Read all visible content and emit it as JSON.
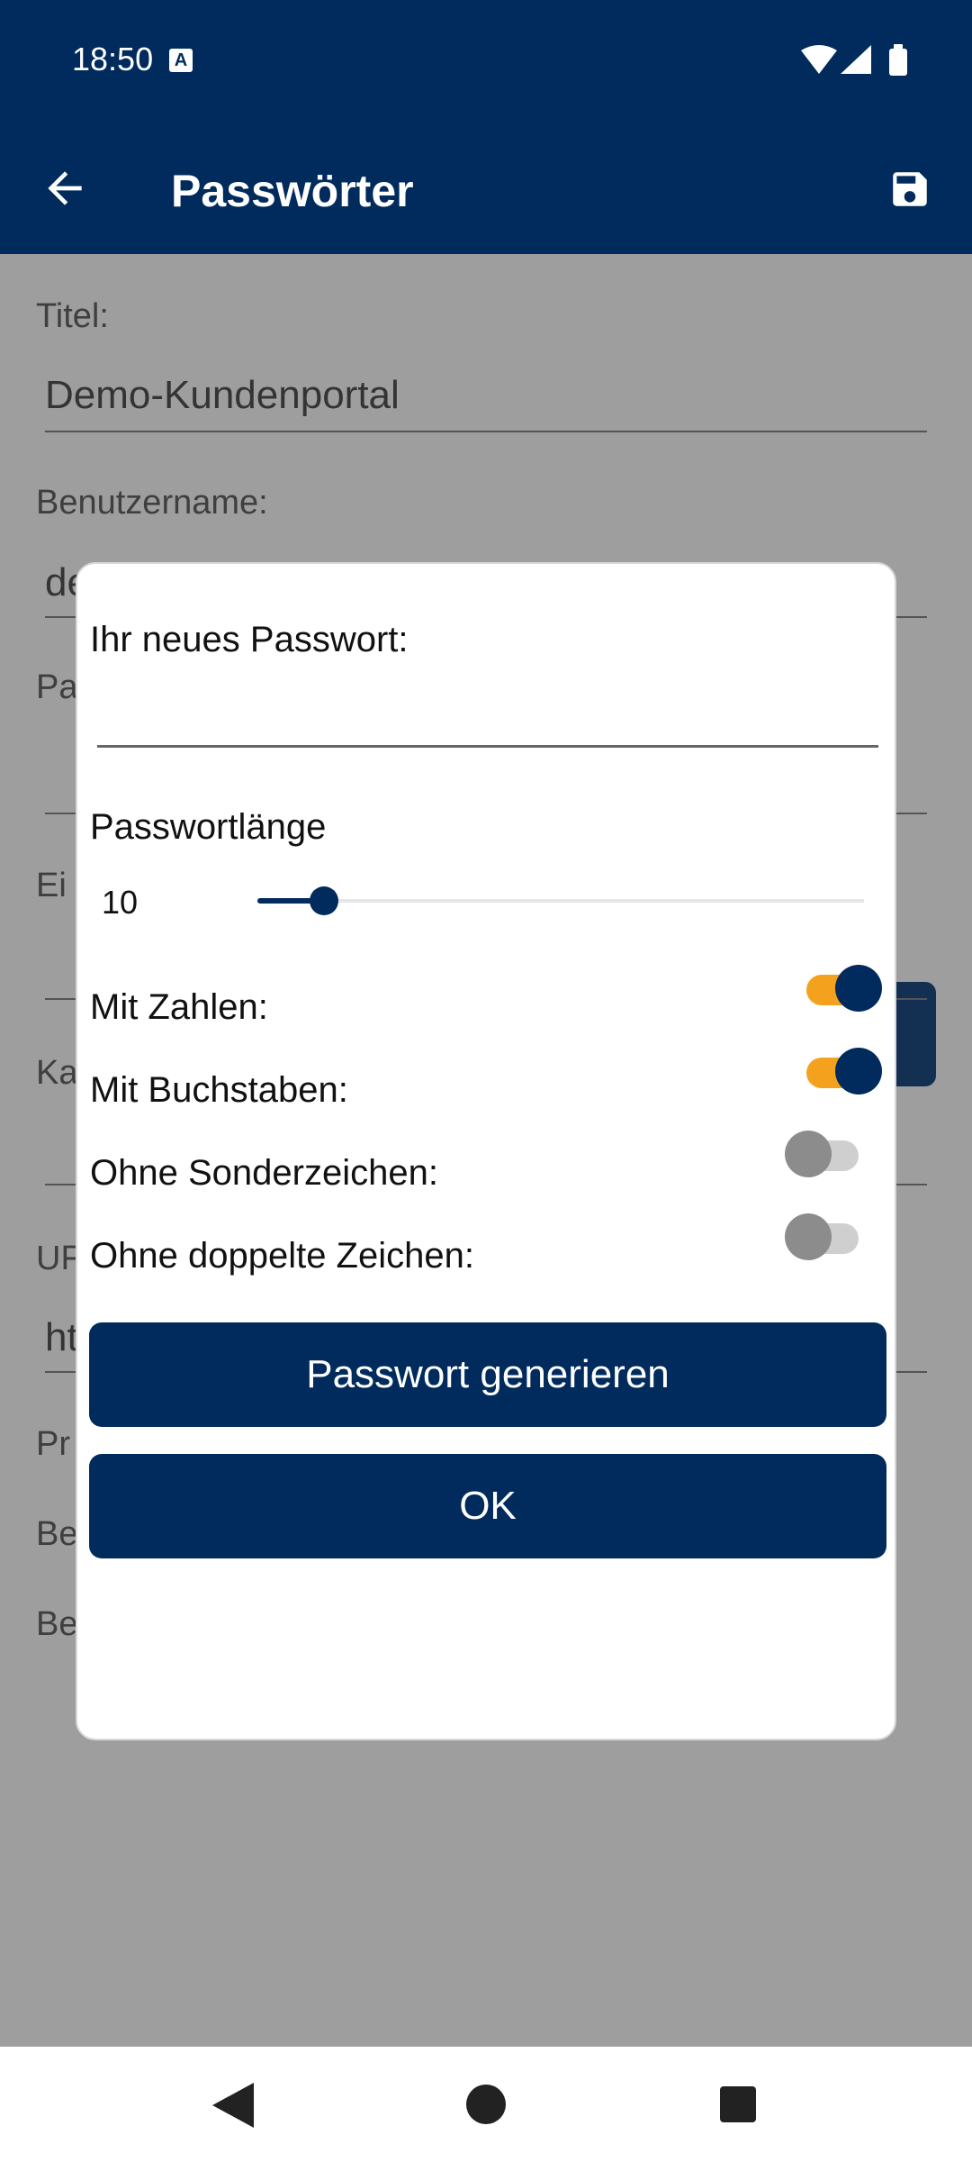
{
  "status_bar": {
    "time": "18:50",
    "notification_icon": "A",
    "icons": [
      "wifi-icon",
      "signal-icon",
      "battery-icon"
    ]
  },
  "app_bar": {
    "title": "Passwörter",
    "back_icon": "arrow-left-icon",
    "save_icon": "save-icon"
  },
  "form": {
    "title_label": "Titel:",
    "title_value": "Demo-Kundenportal",
    "username_label": "Benutzername:",
    "username_value_partial": "de",
    "password_label_partial": "Pa",
    "label_partial_4": "Ei",
    "label_partial_5": "Ka",
    "url_label_partial": "UF",
    "url_value_partial": "ht",
    "label_partial_7": "Pr",
    "label_partial_8": "Be",
    "label_partial_9": "Be"
  },
  "dialog": {
    "new_password_label": "Ihr neues Passwort:",
    "new_password_value": "",
    "length_label": "Passwortlänge",
    "length_value": "10",
    "length_slider_fraction": 0.11,
    "options": [
      {
        "label": "Mit Zahlen:",
        "checked": true
      },
      {
        "label": "Mit Buchstaben:",
        "checked": true
      },
      {
        "label": "Ohne Sonderzeichen:",
        "checked": false
      },
      {
        "label": "Ohne doppelte Zeichen:",
        "checked": false
      }
    ],
    "generate_label": "Passwort generieren",
    "ok_label": "OK"
  },
  "colors": {
    "primary": "#002b5c",
    "toggle_track_on": "#f4a21e",
    "toggle_thumb_off": "#8c8c8c"
  }
}
